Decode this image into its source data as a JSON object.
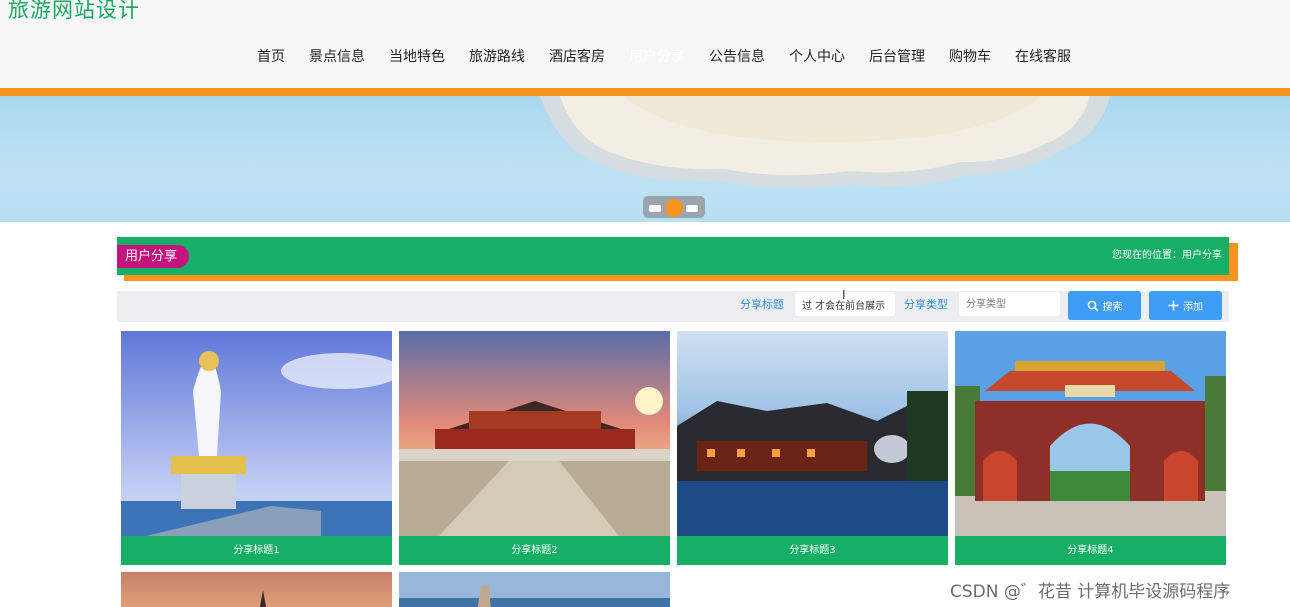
{
  "header": {
    "site_title": "旅游网站设计",
    "nav": [
      "首页",
      "景点信息",
      "当地特色",
      "旅游路线",
      "酒店客房",
      "用户分享",
      "公告信息",
      "个人中心",
      "后台管理",
      "购物车",
      "在线客服"
    ],
    "active_nav": "用户分享"
  },
  "colors": {
    "brand_green": "#17ae66",
    "accent_orange": "#f7931e",
    "tag_magenta": "#c4147d",
    "button_blue": "#3d9cf4"
  },
  "section": {
    "tag": "用户分享",
    "location": "您现在的位置：用户分享"
  },
  "search": {
    "title_label": "分享标题",
    "title_value": "过 才会在前台展示",
    "type_label": "分享类型",
    "type_placeholder": "分享类型",
    "search_button": "搜索",
    "add_button": "添加"
  },
  "cards": [
    {
      "caption": "分享标题1",
      "image": "guanyin-statue-seaside"
    },
    {
      "caption": "分享标题2",
      "image": "forbidden-city-sunset"
    },
    {
      "caption": "分享标题3",
      "image": "xitang-water-town-night"
    },
    {
      "caption": "分享标题4",
      "image": "red-temple-gate"
    }
  ],
  "watermark": "CSDN @゛花昔 计算机毕设源码程序"
}
